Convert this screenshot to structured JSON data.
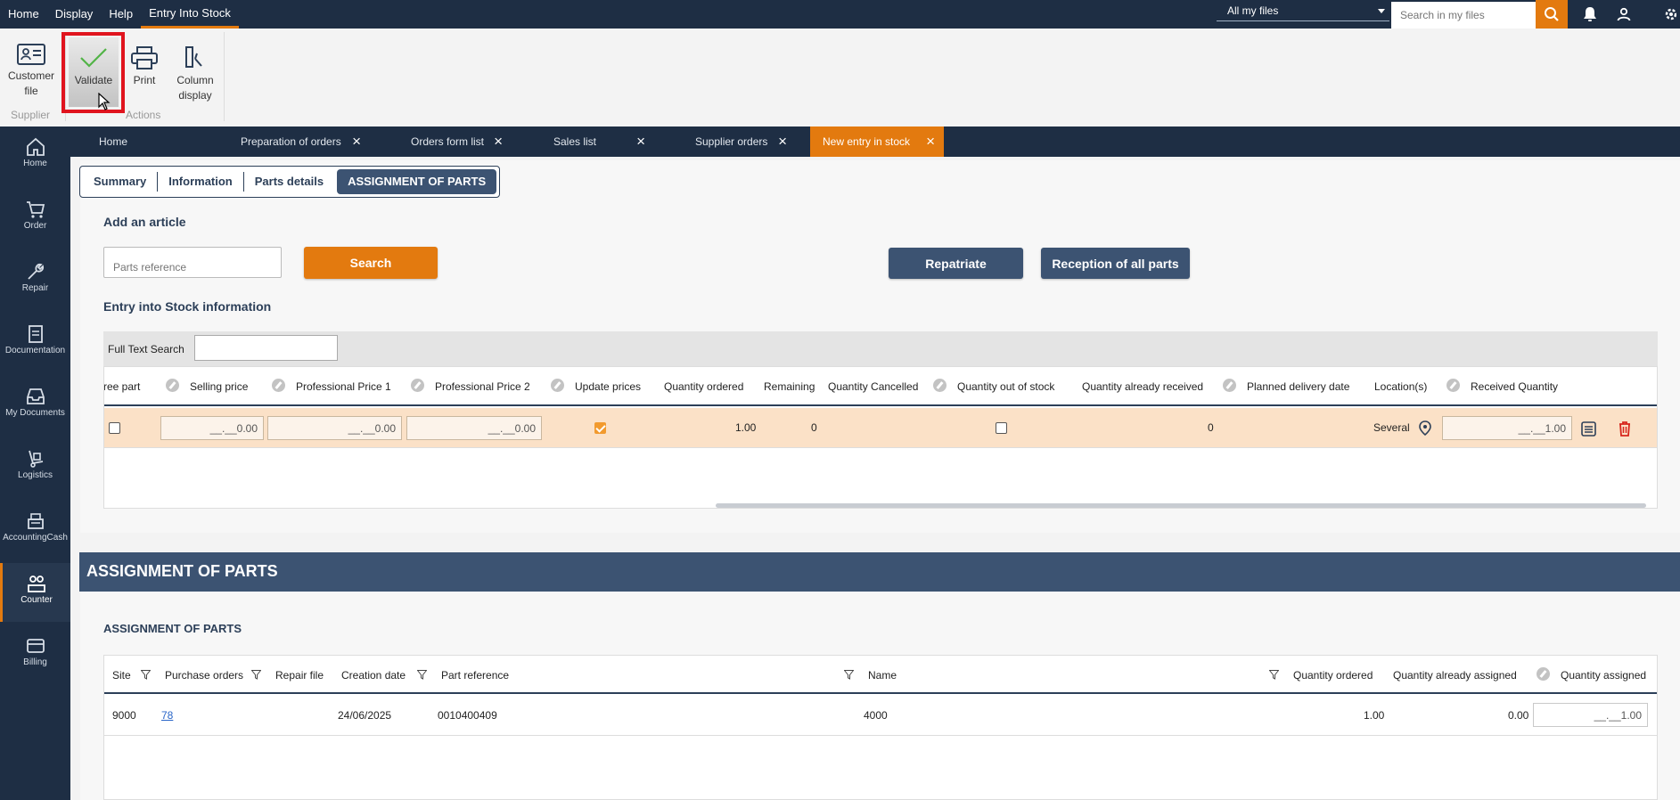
{
  "topbar": {
    "menu": [
      "Home",
      "Display",
      "Help",
      "Entry Into Stock"
    ],
    "files_select": "All my files",
    "search_placeholder": "Search in my files"
  },
  "ribbon": {
    "customer_file": "Customer file",
    "validate": "Validate",
    "print": "Print",
    "column_display": "Column display",
    "group_supplier": "Supplier",
    "group_actions": "Actions"
  },
  "leftnav": {
    "items": [
      "Home",
      "Order",
      "Repair",
      "Documentation",
      "My Documents",
      "Logistics",
      "AccountingCash",
      "Counter",
      "Billing"
    ],
    "active": "Counter"
  },
  "doc_tabs": [
    "Home",
    "Preparation of orders",
    "Orders form list",
    "Sales list",
    "Supplier orders",
    "New entry in stock"
  ],
  "subtabs": [
    "Summary",
    "Information",
    "Parts details",
    "ASSIGNMENT OF PARTS"
  ],
  "add_article": {
    "title": "Add an article",
    "parts_placeholder": "Parts reference",
    "search_button": "Search",
    "repatriate_button": "Repatriate",
    "reception_button": "Reception of all parts"
  },
  "stock_info": {
    "title": "Entry into Stock information",
    "full_text_search_label": "Full Text Search",
    "columns": [
      "ree part",
      "Selling price",
      "Professional Price 1",
      "Professional Price 2",
      "Update prices",
      "Quantity ordered",
      "Remaining",
      "Quantity Cancelled",
      "Quantity out of stock",
      "Quantity already received",
      "Planned delivery date",
      "Location(s)",
      "Received Quantity"
    ],
    "row": {
      "free_part_checked": false,
      "selling_price": "__.__0.00",
      "professional_price_1": "__.__0.00",
      "professional_price_2": "__.__0.00",
      "update_prices_checked": true,
      "quantity_ordered": "1.00",
      "remaining": "0",
      "quantity_out_of_stock_checked": false,
      "quantity_already_received": "0",
      "locations": "Several",
      "received_quantity": "__.__1.00"
    }
  },
  "assignment": {
    "header": "ASSIGNMENT OF PARTS",
    "subtitle": "ASSIGNMENT OF PARTS",
    "columns": [
      "Site",
      "Purchase orders",
      "Repair file",
      "Creation date",
      "Part reference",
      "Name",
      "Quantity ordered",
      "Quantity already assigned",
      "Quantity assigned"
    ],
    "row": {
      "site": "9000",
      "purchase_order": "78",
      "repair_file": "",
      "creation_date": "24/06/2025",
      "part_reference": "0010400409",
      "name": "4000",
      "quantity_ordered": "1.00",
      "quantity_already_assigned": "0.00",
      "quantity_assigned": "__.__1.00"
    }
  },
  "colors": {
    "navy": "#1e2e44",
    "accent": "#e37a0f",
    "button_navy": "#3c5372",
    "highlight": "#e0141e"
  }
}
